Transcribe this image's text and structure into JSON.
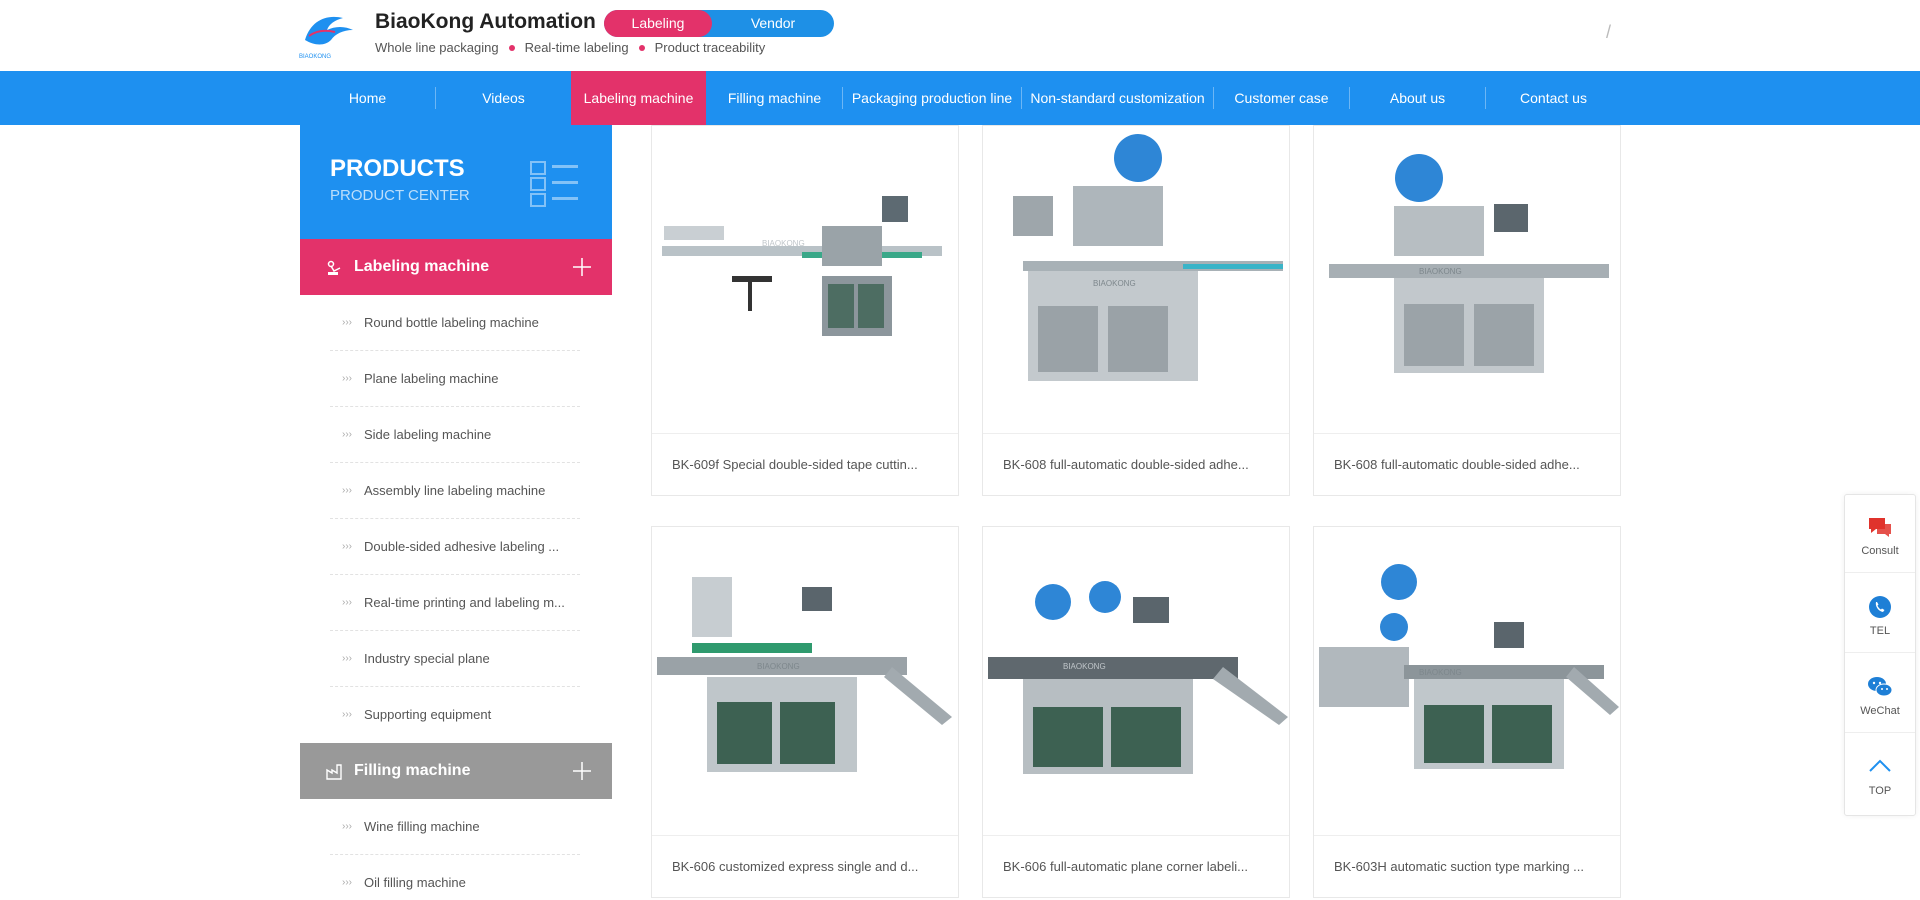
{
  "header": {
    "brand_name": "BiaoKong Automation",
    "logo_text": "BIAOKONG",
    "pill_primary": "Labeling Machine",
    "pill_secondary": "Vendor",
    "taglines": [
      "Whole line packaging",
      "Real-time labeling",
      "Product traceability"
    ],
    "divider_text": "/"
  },
  "nav": {
    "items": [
      {
        "label": "Home"
      },
      {
        "label": "Videos"
      },
      {
        "label": "Labeling machine",
        "active": true
      },
      {
        "label": "Filling machine"
      },
      {
        "label": "Packaging production line"
      },
      {
        "label": "Non-standard customization"
      },
      {
        "label": "Customer case"
      },
      {
        "label": "About us"
      },
      {
        "label": "Contact us"
      }
    ]
  },
  "sidebar": {
    "title": "PRODUCTS",
    "subtitle": "PRODUCT CENTER",
    "categories": [
      {
        "label": "Labeling machine",
        "color": "#e3326a",
        "icon": "robot-arm-icon",
        "items": [
          "Round bottle labeling machine",
          "Plane labeling machine",
          "Side labeling machine",
          "Assembly line labeling machine",
          "Double-sided adhesive labeling ...",
          "Real-time printing and labeling m...",
          "Industry special plane",
          "Supporting equipment"
        ]
      },
      {
        "label": "Filling machine",
        "color": "#999999",
        "icon": "factory-icon",
        "items": [
          "Wine filling machine",
          "Oil filling machine"
        ]
      }
    ]
  },
  "products": [
    {
      "caption": "BK-609f Special double-sided tape cuttin..."
    },
    {
      "caption": "BK-608 full-automatic double-sided adhe..."
    },
    {
      "caption": "BK-608 full-automatic double-sided adhe..."
    },
    {
      "caption": "BK-606 customized express single and d..."
    },
    {
      "caption": "BK-606 full-automatic plane corner labeli..."
    },
    {
      "caption": "BK-603H automatic suction type marking ..."
    }
  ],
  "machine_watermark": "BIAOKONG",
  "float_widget": {
    "items": [
      {
        "label": "Consult",
        "icon": "chat-bubble-icon"
      },
      {
        "label": "TEL",
        "icon": "phone-icon"
      },
      {
        "label": "WeChat",
        "icon": "wechat-icon"
      },
      {
        "label": "TOP",
        "icon": "arrow-up-icon"
      }
    ]
  },
  "colors": {
    "primary_blue": "#1e90f0",
    "accent_pink": "#e3326a",
    "filling_gray": "#999999"
  }
}
